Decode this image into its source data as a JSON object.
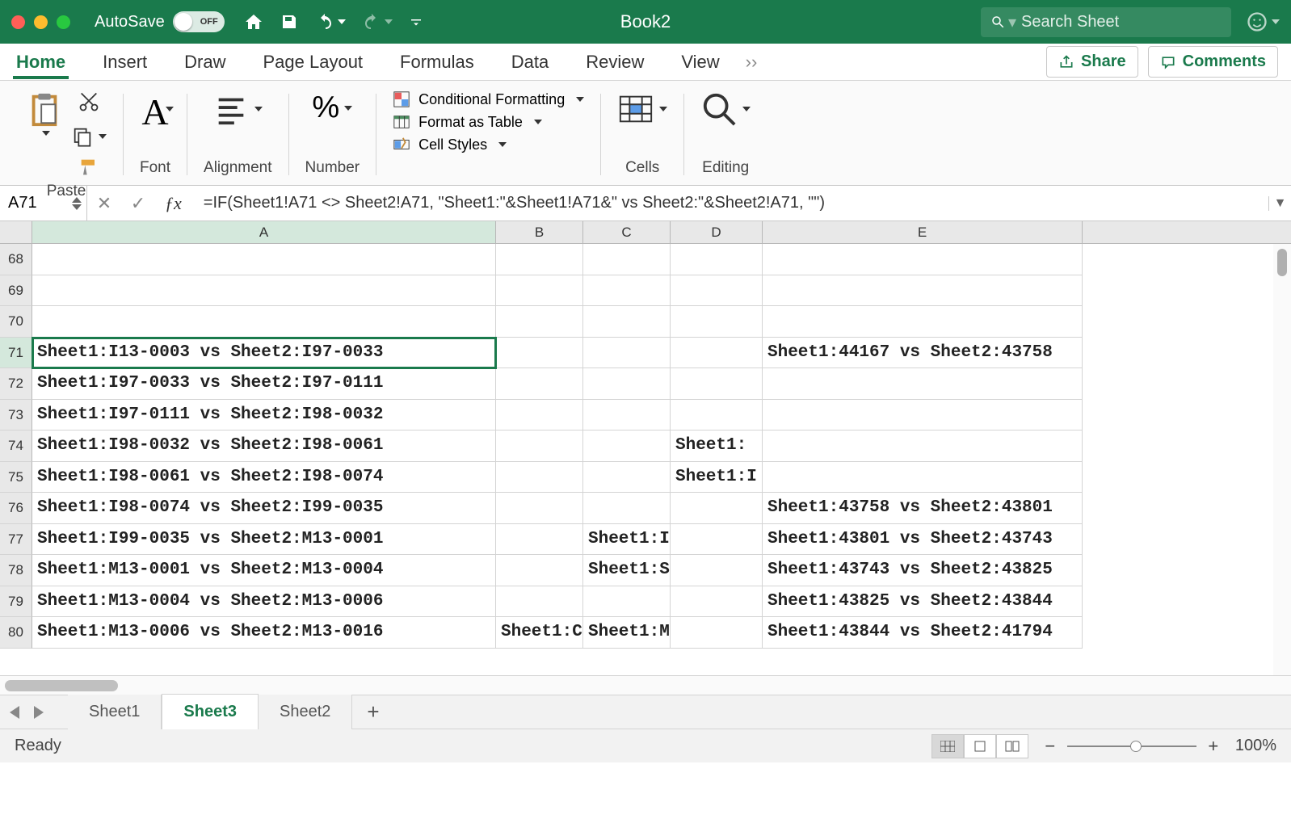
{
  "titlebar": {
    "autosave_label": "AutoSave",
    "autosave_state": "OFF",
    "doc_title": "Book2",
    "search_placeholder": "Search Sheet"
  },
  "ribbon": {
    "tabs": [
      "Home",
      "Insert",
      "Draw",
      "Page Layout",
      "Formulas",
      "Data",
      "Review",
      "View"
    ],
    "share": "Share",
    "comments": "Comments",
    "groups": {
      "paste": "Paste",
      "font": "Font",
      "alignment": "Alignment",
      "number": "Number",
      "cond_format": "Conditional Formatting",
      "format_table": "Format as Table",
      "cell_styles": "Cell Styles",
      "cells": "Cells",
      "editing": "Editing"
    }
  },
  "formula_bar": {
    "name_box": "A71",
    "formula": "=IF(Sheet1!A71 <> Sheet2!A71, \"Sheet1:\"&Sheet1!A71&\" vs Sheet2:\"&Sheet2!A71, \"\")"
  },
  "columns": [
    "A",
    "B",
    "C",
    "D",
    "E"
  ],
  "rows": [
    {
      "n": 68,
      "A": "",
      "B": "",
      "C": "",
      "D": "",
      "E": ""
    },
    {
      "n": 69,
      "A": "",
      "B": "",
      "C": "",
      "D": "",
      "E": ""
    },
    {
      "n": 70,
      "A": "",
      "B": "",
      "C": "",
      "D": "",
      "E": ""
    },
    {
      "n": 71,
      "A": "Sheet1:I13-0003 vs Sheet2:I97-0033",
      "B": "",
      "C": "",
      "D": "",
      "E": "Sheet1:44167 vs Sheet2:43758"
    },
    {
      "n": 72,
      "A": "Sheet1:I97-0033 vs Sheet2:I97-0111",
      "B": "",
      "C": "",
      "D": "",
      "E": ""
    },
    {
      "n": 73,
      "A": "Sheet1:I97-0111 vs Sheet2:I98-0032",
      "B": "",
      "C": "",
      "D": "",
      "E": ""
    },
    {
      "n": 74,
      "A": "Sheet1:I98-0032 vs Sheet2:I98-0061",
      "B": "",
      "C": "",
      "D": "Sheet1:",
      "E": ""
    },
    {
      "n": 75,
      "A": "Sheet1:I98-0061 vs Sheet2:I98-0074",
      "B": "",
      "C": "",
      "D": "Sheet1:I",
      "E": ""
    },
    {
      "n": 76,
      "A": "Sheet1:I98-0074 vs Sheet2:I99-0035",
      "B": "",
      "C": "",
      "D": "",
      "E": "Sheet1:43758 vs Sheet2:43801"
    },
    {
      "n": 77,
      "A": "Sheet1:I99-0035 vs Sheet2:M13-0001",
      "B": "",
      "C": "Sheet1:I",
      "D": "",
      "E": "Sheet1:43801 vs Sheet2:43743"
    },
    {
      "n": 78,
      "A": "Sheet1:M13-0001 vs Sheet2:M13-0004",
      "B": "",
      "C": "Sheet1:S",
      "D": "",
      "E": "Sheet1:43743 vs Sheet2:43825"
    },
    {
      "n": 79,
      "A": "Sheet1:M13-0004 vs Sheet2:M13-0006",
      "B": "",
      "C": "",
      "D": "",
      "E": "Sheet1:43825 vs Sheet2:43844"
    },
    {
      "n": 80,
      "A": "Sheet1:M13-0006 vs Sheet2:M13-0016",
      "B": "Sheet1:C",
      "C": "Sheet1:M",
      "D": "",
      "E": "Sheet1:43844 vs Sheet2:41794"
    }
  ],
  "sheets": [
    "Sheet1",
    "Sheet3",
    "Sheet2"
  ],
  "active_sheet": "Sheet3",
  "status": {
    "ready": "Ready",
    "zoom": "100%"
  }
}
